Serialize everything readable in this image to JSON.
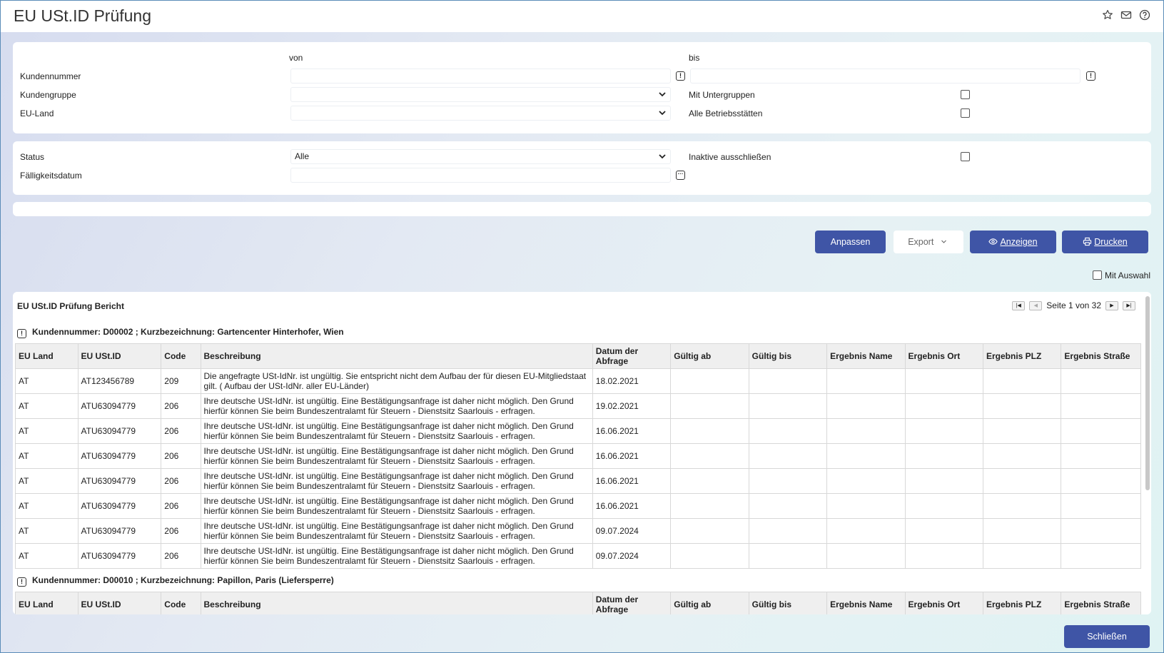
{
  "app": {
    "title": "EU USt.ID Prüfung",
    "icons": [
      "star-icon",
      "mail-icon",
      "help-icon"
    ]
  },
  "filter": {
    "von_label": "von",
    "bis_label": "bis",
    "kundennummer_label": "Kundennummer",
    "kundennummer_von": "",
    "kundennummer_bis": "",
    "kundengruppe_label": "Kundengruppe",
    "kundengruppe_value": "",
    "mit_untergruppen_label": "Mit Untergruppen",
    "eu_land_label": "EU-Land",
    "eu_land_value": "",
    "alle_betriebsstaetten_label": "Alle Betriebsstätten",
    "status_label": "Status",
    "status_value": "Alle",
    "inaktive_label": "Inaktive ausschließen",
    "faelligkeitsdatum_label": "Fälligkeitsdatum",
    "faelligkeitsdatum_value": ""
  },
  "buttons": {
    "anpassen": "Anpassen",
    "export": "Export",
    "anzeigen": "Anzeigen",
    "drucken": "Drucken",
    "schliessen": "Schließen",
    "mit_auswahl": "Mit Auswahl"
  },
  "report": {
    "title": "EU USt.ID Prüfung Bericht",
    "page_info": "Seite 1 von 32",
    "columns": [
      "EU Land",
      "EU USt.ID",
      "Code",
      "Beschreibung",
      "Datum der Abfrage",
      "Gültig ab",
      "Gültig bis",
      "Ergebnis Name",
      "Ergebnis Ort",
      "Ergebnis PLZ",
      "Ergebnis Straße"
    ],
    "groups": [
      {
        "header": "Kundennummer: D00002 ; Kurzbezeichnung: Gartencenter Hinterhofer, Wien",
        "rows": [
          [
            "AT",
            "AT123456789",
            "209",
            "Die angefragte USt-IdNr. ist ungültig. Sie entspricht nicht dem Aufbau der für diesen EU-Mitgliedstaat gilt. ( Aufbau der USt-IdNr. aller EU-Länder)",
            "18.02.2021",
            "",
            "",
            "",
            "",
            "",
            ""
          ],
          [
            "AT",
            "ATU63094779",
            "206",
            "Ihre deutsche USt-IdNr. ist ungültig. Eine Bestätigungsanfrage ist daher nicht möglich. Den Grund hierfür können Sie beim Bundeszentralamt für Steuern - Dienstsitz Saarlouis - erfragen.",
            "19.02.2021",
            "",
            "",
            "",
            "",
            "",
            ""
          ],
          [
            "AT",
            "ATU63094779",
            "206",
            "Ihre deutsche USt-IdNr. ist ungültig. Eine Bestätigungsanfrage ist daher nicht möglich. Den Grund hierfür können Sie beim Bundeszentralamt für Steuern - Dienstsitz Saarlouis - erfragen.",
            "16.06.2021",
            "",
            "",
            "",
            "",
            "",
            ""
          ],
          [
            "AT",
            "ATU63094779",
            "206",
            "Ihre deutsche USt-IdNr. ist ungültig. Eine Bestätigungsanfrage ist daher nicht möglich. Den Grund hierfür können Sie beim Bundeszentralamt für Steuern - Dienstsitz Saarlouis - erfragen.",
            "16.06.2021",
            "",
            "",
            "",
            "",
            "",
            ""
          ],
          [
            "AT",
            "ATU63094779",
            "206",
            "Ihre deutsche USt-IdNr. ist ungültig. Eine Bestätigungsanfrage ist daher nicht möglich. Den Grund hierfür können Sie beim Bundeszentralamt für Steuern - Dienstsitz Saarlouis - erfragen.",
            "16.06.2021",
            "",
            "",
            "",
            "",
            "",
            ""
          ],
          [
            "AT",
            "ATU63094779",
            "206",
            "Ihre deutsche USt-IdNr. ist ungültig. Eine Bestätigungsanfrage ist daher nicht möglich. Den Grund hierfür können Sie beim Bundeszentralamt für Steuern - Dienstsitz Saarlouis - erfragen.",
            "16.06.2021",
            "",
            "",
            "",
            "",
            "",
            ""
          ],
          [
            "AT",
            "ATU63094779",
            "206",
            "Ihre deutsche USt-IdNr. ist ungültig. Eine Bestätigungsanfrage ist daher nicht möglich. Den Grund hierfür können Sie beim Bundeszentralamt für Steuern - Dienstsitz Saarlouis - erfragen.",
            "09.07.2024",
            "",
            "",
            "",
            "",
            "",
            ""
          ],
          [
            "AT",
            "ATU63094779",
            "206",
            "Ihre deutsche USt-IdNr. ist ungültig. Eine Bestätigungsanfrage ist daher nicht möglich. Den Grund hierfür können Sie beim Bundeszentralamt für Steuern - Dienstsitz Saarlouis - erfragen.",
            "09.07.2024",
            "",
            "",
            "",
            "",
            "",
            ""
          ]
        ]
      },
      {
        "header": "Kundennummer: D00010 ; Kurzbezeichnung: Papillon, Paris (Liefersperre)",
        "rows": []
      }
    ]
  }
}
